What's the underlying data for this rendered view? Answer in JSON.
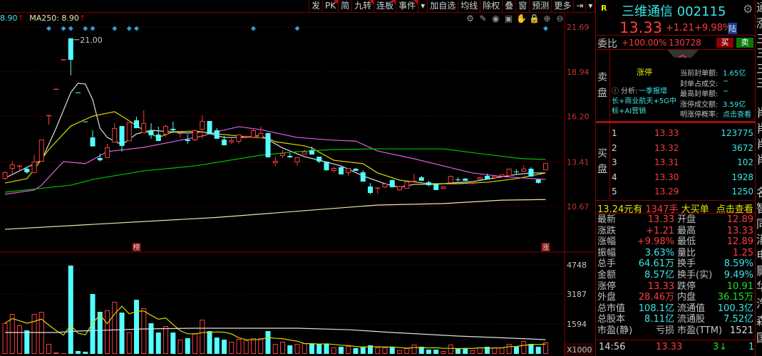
{
  "toolbar": {
    "buttons": [
      {
        "label": "发",
        "corner": false
      },
      {
        "label": "PK",
        "corner": true
      },
      {
        "label": "简",
        "corner": false
      },
      {
        "label": "九转",
        "corner": true
      },
      {
        "label": "连板",
        "corner": true
      },
      {
        "label": "事件",
        "corner": true
      },
      {
        "label": "▾",
        "corner": false
      },
      {
        "label": "加自选",
        "corner": false
      },
      {
        "label": "均线",
        "corner": false
      },
      {
        "label": "除权",
        "corner": false
      },
      {
        "label": "叠",
        "corner": false
      },
      {
        "label": "窗",
        "corner": false
      },
      {
        "label": "预测",
        "corner": false
      },
      {
        "label": "更多",
        "corner": false
      },
      {
        "label": "⇥",
        "corner": false
      },
      {
        "label": "▾",
        "corner": false
      }
    ],
    "tools": [
      {
        "name": "settings-icon",
        "glyph": "⚙"
      },
      {
        "name": "pen-icon",
        "glyph": "✎"
      },
      {
        "name": "eye-icon",
        "glyph": "◉"
      },
      {
        "name": "toolbox-icon",
        "glyph": "▣"
      },
      {
        "name": "hand-icon",
        "glyph": "✋"
      },
      {
        "name": "lock-icon",
        "glyph": "🔒"
      },
      {
        "name": "zoom-in-icon",
        "glyph": "⊕"
      },
      {
        "name": "zoom-out-icon",
        "glyph": "⊖"
      }
    ]
  },
  "legend": {
    "ma_prev_value": "8.90",
    "ma_prev_arrow": "↑",
    "ma250_label": "MA250: 8.90",
    "ma250_arrow": "↑"
  },
  "chart_data": {
    "type": "candlestick",
    "price_axis": {
      "ticks": [
        "21.69",
        "18.94",
        "16.20",
        "13.41",
        "10.67"
      ],
      "tick_values": [
        21.69,
        18.94,
        16.2,
        13.41,
        10.67
      ]
    },
    "volume_axis": {
      "ticks": [
        "4748",
        "3187",
        "1594"
      ],
      "tick_values": [
        4748,
        3187,
        1594
      ],
      "unit_label": "X1000"
    },
    "high_annotation": {
      "label": "21.00",
      "index": 9,
      "value": 21.0
    },
    "candles_ohlc": [
      [
        12.38,
        12.86,
        12.29,
        12.77
      ],
      [
        12.99,
        13.43,
        12.68,
        13.25
      ],
      [
        13.16,
        13.21,
        12.86,
        13.18
      ],
      [
        12.99,
        13.08,
        12.68,
        12.77
      ],
      [
        12.73,
        13.86,
        12.73,
        13.43
      ],
      [
        13.43,
        14.78,
        13.43,
        14.78
      ],
      [
        16.27,
        16.27,
        15.7,
        16.28
      ],
      [
        17.89,
        17.9,
        17.89,
        17.9
      ],
      [
        19.68,
        19.72,
        19.68,
        19.72
      ],
      [
        21.0,
        21.0,
        18.72,
        19.68
      ],
      [
        17.68,
        17.68,
        17.67,
        17.67
      ],
      [
        15.89,
        15.89,
        15.88,
        15.88
      ],
      [
        14.91,
        15.35,
        14.36,
        14.36
      ],
      [
        13.65,
        13.91,
        13.43,
        13.51
      ],
      [
        13.65,
        14.52,
        13.65,
        14.3
      ],
      [
        14.61,
        15.79,
        14.61,
        15.48
      ],
      [
        15.61,
        15.61,
        14.04,
        14.39
      ],
      [
        14.69,
        15.83,
        14.69,
        15.83
      ],
      [
        15.96,
        16.18,
        15.48,
        15.48
      ],
      [
        15.18,
        16.57,
        15.18,
        15.79
      ],
      [
        15.35,
        15.79,
        14.83,
        15.04
      ],
      [
        15.09,
        15.57,
        14.69,
        14.69
      ],
      [
        15.09,
        15.7,
        14.96,
        15.61
      ],
      [
        15.44,
        15.88,
        15.18,
        15.35
      ],
      [
        15.18,
        15.31,
        14.91,
        15.2
      ],
      [
        14.78,
        15.09,
        14.52,
        14.69
      ],
      [
        14.74,
        15.4,
        14.69,
        15.35
      ],
      [
        15.39,
        16.27,
        14.83,
        15.92
      ],
      [
        15.92,
        15.92,
        15.13,
        15.13
      ],
      [
        15.35,
        15.48,
        14.83,
        14.83
      ],
      [
        14.78,
        15.0,
        14.43,
        14.43
      ],
      [
        14.61,
        14.91,
        14.52,
        14.74
      ],
      [
        14.65,
        15.09,
        14.52,
        15.09
      ],
      [
        14.91,
        15.04,
        14.87,
        15.0
      ],
      [
        14.91,
        15.48,
        14.87,
        15.35
      ],
      [
        14.87,
        15.57,
        14.87,
        15.18
      ],
      [
        15.18,
        15.18,
        13.69,
        13.69
      ],
      [
        13.34,
        13.73,
        13.16,
        13.47
      ],
      [
        13.78,
        14.13,
        13.65,
        13.95
      ],
      [
        13.78,
        13.95,
        13.65,
        13.69
      ],
      [
        13.38,
        13.69,
        13.16,
        13.69
      ],
      [
        13.86,
        14.17,
        13.86,
        14.04
      ],
      [
        14.13,
        14.36,
        13.86,
        13.86
      ],
      [
        13.73,
        13.73,
        13.34,
        13.43
      ],
      [
        13.43,
        13.43,
        12.86,
        12.9
      ],
      [
        12.86,
        13.12,
        12.77,
        13.03
      ],
      [
        13.08,
        13.12,
        12.64,
        12.64
      ],
      [
        12.73,
        13.03,
        12.55,
        13.03
      ],
      [
        12.99,
        13.03,
        12.86,
        12.86
      ],
      [
        12.77,
        12.9,
        12.2,
        12.2
      ],
      [
        11.9,
        12.11,
        11.42,
        11.5
      ],
      [
        11.81,
        11.81,
        11.46,
        11.83
      ],
      [
        11.85,
        12.07,
        11.8,
        12.07
      ],
      [
        12.29,
        12.33,
        11.85,
        11.85
      ],
      [
        11.68,
        11.95,
        11.65,
        11.9
      ],
      [
        11.76,
        12.2,
        11.76,
        12.2
      ],
      [
        12.22,
        12.68,
        12.2,
        12.25
      ],
      [
        12.46,
        12.55,
        12.25,
        12.25
      ],
      [
        12.16,
        12.25,
        11.9,
        11.98
      ],
      [
        12.03,
        12.07,
        11.68,
        11.68
      ],
      [
        11.76,
        11.9,
        11.72,
        11.9
      ],
      [
        12.11,
        12.55,
        12.11,
        12.55
      ],
      [
        12.33,
        12.46,
        12.2,
        12.32
      ],
      [
        12.38,
        12.42,
        12.25,
        12.25
      ],
      [
        12.07,
        12.2,
        12.03,
        12.16
      ],
      [
        12.33,
        12.46,
        12.33,
        12.46
      ],
      [
        12.55,
        12.68,
        12.33,
        12.33
      ],
      [
        12.42,
        12.55,
        12.42,
        12.55
      ],
      [
        12.51,
        12.64,
        12.51,
        12.64
      ],
      [
        12.55,
        12.99,
        12.55,
        12.99
      ],
      [
        12.82,
        12.95,
        12.68,
        12.81
      ],
      [
        12.81,
        13.21,
        12.81,
        12.99
      ],
      [
        12.99,
        13.08,
        12.51,
        12.51
      ],
      [
        12.33,
        12.33,
        12.07,
        12.12
      ],
      [
        12.89,
        13.33,
        12.89,
        13.33
      ]
    ],
    "volumes": [
      1640,
      2128,
      1520,
      1254,
      2128,
      2242,
      532,
      76,
      40,
      4712,
      152,
      114,
      3192,
      2242,
      2318,
      2774,
      2204,
      1140,
      2888,
      2432,
      1634,
      1140,
      1482,
      1140,
      760,
      836,
      1102,
      1824,
      1216,
      874,
      760,
      646,
      798,
      722,
      836,
      836,
      1216,
      532,
      646,
      456,
      532,
      570,
      532,
      532,
      532,
      342,
      380,
      418,
      304,
      380,
      456,
      342,
      342,
      342,
      190,
      304,
      494,
      380,
      228,
      228,
      152,
      494,
      304,
      304,
      190,
      342,
      380,
      342,
      342,
      532,
      380,
      684,
      532,
      380,
      608
    ],
    "ma_lines": [
      {
        "name": "MA5",
        "color": "#e0e0e0",
        "points": [
          [
            0,
            12.42
          ],
          [
            5,
            13.51
          ],
          [
            7,
            15.48
          ],
          [
            9,
            17.67
          ],
          [
            10,
            18.24
          ],
          [
            11,
            18.19
          ],
          [
            12,
            17.23
          ],
          [
            13,
            15.48
          ],
          [
            14,
            14.91
          ],
          [
            16,
            14.47
          ],
          [
            18,
            15.13
          ],
          [
            20,
            15.35
          ],
          [
            25,
            15.18
          ],
          [
            27,
            15.26
          ],
          [
            30,
            14.91
          ],
          [
            33,
            14.91
          ],
          [
            35,
            15.04
          ],
          [
            38,
            14.26
          ],
          [
            41,
            13.73
          ],
          [
            44,
            13.4
          ],
          [
            46,
            13.16
          ],
          [
            49,
            12.55
          ],
          [
            52,
            12.07
          ],
          [
            54,
            11.85
          ],
          [
            56,
            12.03
          ],
          [
            59,
            12.03
          ],
          [
            61,
            12.11
          ],
          [
            64,
            12.2
          ],
          [
            67,
            12.42
          ],
          [
            70,
            12.64
          ],
          [
            72,
            12.73
          ],
          [
            74,
            12.73
          ]
        ]
      },
      {
        "name": "MA10",
        "color": "#d8d800",
        "points": [
          [
            0,
            12.11
          ],
          [
            3,
            12.38
          ],
          [
            4,
            12.95
          ],
          [
            6,
            14.17
          ],
          [
            9,
            15.61
          ],
          [
            12,
            16.22
          ],
          [
            15,
            16.49
          ],
          [
            16,
            16.22
          ],
          [
            19,
            15.35
          ],
          [
            21,
            14.91
          ],
          [
            23,
            15.26
          ],
          [
            26,
            15.3
          ],
          [
            29,
            15.13
          ],
          [
            33,
            14.96
          ],
          [
            36,
            14.85
          ],
          [
            37,
            14.65
          ],
          [
            41,
            14.39
          ],
          [
            42,
            14.26
          ],
          [
            45,
            13.51
          ],
          [
            49,
            13.3
          ],
          [
            51,
            12.73
          ],
          [
            54,
            12.29
          ],
          [
            58,
            12.07
          ],
          [
            62,
            12.07
          ],
          [
            66,
            12.16
          ],
          [
            70,
            12.38
          ],
          [
            74,
            12.73
          ]
        ]
      },
      {
        "name": "MA20",
        "color": "#e060e0",
        "points": [
          [
            0,
            11.42
          ],
          [
            4,
            11.68
          ],
          [
            5,
            11.98
          ],
          [
            8,
            13.43
          ],
          [
            11,
            13.3
          ],
          [
            14,
            14.04
          ],
          [
            19,
            14.3
          ],
          [
            24,
            14.74
          ],
          [
            27,
            15.0
          ],
          [
            29,
            15.26
          ],
          [
            32,
            15.57
          ],
          [
            35,
            15.39
          ],
          [
            40,
            14.91
          ],
          [
            45,
            14.74
          ],
          [
            48,
            14.69
          ],
          [
            51,
            14.08
          ],
          [
            56,
            13.6
          ],
          [
            60,
            13.16
          ],
          [
            64,
            12.73
          ],
          [
            68,
            12.51
          ],
          [
            74,
            12.33
          ]
        ]
      },
      {
        "name": "MA60",
        "color": "#00c000",
        "points": [
          [
            0,
            11.55
          ],
          [
            9,
            11.98
          ],
          [
            12,
            12.33
          ],
          [
            19,
            12.86
          ],
          [
            26,
            13.16
          ],
          [
            35,
            13.82
          ],
          [
            40,
            14.04
          ],
          [
            45,
            14.17
          ],
          [
            51,
            14.21
          ],
          [
            60,
            14.21
          ],
          [
            66,
            13.86
          ],
          [
            71,
            13.6
          ],
          [
            74,
            13.56
          ]
        ]
      },
      {
        "name": "MA250",
        "color": "#e8e8b0",
        "points": [
          [
            0,
            9.27
          ],
          [
            29,
            10.0
          ],
          [
            51,
            10.76
          ],
          [
            60,
            10.85
          ],
          [
            68,
            11.06
          ],
          [
            74,
            11.1
          ]
        ]
      }
    ],
    "volume_ma_lines": [
      {
        "name": "VOL-MA-long",
        "color": "#e0e0e0",
        "points": [
          [
            0,
            1140
          ],
          [
            7,
            1140
          ],
          [
            10,
            1216
          ],
          [
            19,
            1330
          ],
          [
            26,
            1368
          ],
          [
            40,
            1368
          ],
          [
            47,
            1290
          ],
          [
            53,
            1140
          ],
          [
            62,
            950
          ],
          [
            67,
            874
          ],
          [
            74,
            760
          ]
        ]
      }
    ],
    "volume_ma5_color": "#d8d800",
    "event_marker_indices": [
      6,
      8,
      9,
      11,
      12,
      15,
      17,
      18,
      34,
      40,
      74
    ],
    "tags": [
      {
        "label": "榜",
        "index": 18
      },
      {
        "label": "涨",
        "index": 74
      }
    ]
  },
  "quote": {
    "badge": "R",
    "title": "三维通信 002115",
    "price": "13.33",
    "change": "+1.21",
    "change_pct": "+9.98%",
    "market_badge": "陆",
    "wei_bi_label": "委比",
    "wei_bi": "+100.00%",
    "wei_cha": "130728",
    "buy_label": "买",
    "sell_label": "卖",
    "sell_side_label": "卖盘",
    "buy_side_label": "买盘",
    "limit_up": "涨停",
    "analysis_prefix": "分析:",
    "analysis_lines": [
      "一季报增",
      "长+商业航天+5G中",
      "标+AI营销"
    ],
    "seal_info": [
      {
        "label": "当前封单额:",
        "value": "1.65亿"
      },
      {
        "label": "封单占成交:",
        "value": "−"
      },
      {
        "label": "最高封单额:",
        "value": "−"
      },
      {
        "label": "涨停成交额:",
        "value": "3.59亿"
      },
      {
        "label": "明涨停概率:",
        "value": "点击查看"
      }
    ],
    "bids": [
      {
        "level": "1",
        "price": "13.33",
        "volume": "123775"
      },
      {
        "level": "2",
        "price": "13.32",
        "volume": "3672"
      },
      {
        "level": "3",
        "price": "13.31",
        "volume": "102"
      },
      {
        "level": "4",
        "price": "13.30",
        "volume": "1928"
      },
      {
        "level": "5",
        "price": "13.29",
        "volume": "1250"
      }
    ],
    "big_order": {
      "price": "13.24元有",
      "qty": "1347手",
      "text": "大买单",
      "link": "点击查看"
    },
    "stats": [
      {
        "l1": "最新",
        "v1": "13.33",
        "c1": "red",
        "l2": "开盘",
        "v2": "12.89",
        "c2": "red"
      },
      {
        "l1": "涨跌",
        "v1": "+1.21",
        "c1": "red",
        "l2": "最高",
        "v2": "13.33",
        "c2": "red"
      },
      {
        "l1": "涨幅",
        "v1": "+9.98%",
        "c1": "red",
        "l2": "最低",
        "v2": "12.89",
        "c2": "red"
      },
      {
        "l1": "振幅",
        "v1": "3.63%",
        "c1": "cyan",
        "l2": "量比",
        "v2": "1.25",
        "c2": "red"
      },
      {
        "l1": "总手",
        "v1": "64.61万",
        "c1": "cyan",
        "l2": "换手",
        "v2": "8.59%",
        "c2": "cyan"
      },
      {
        "l1": "金额",
        "v1": "8.57亿",
        "c1": "cyan",
        "l2": "换手(实)",
        "v2": "9.49%",
        "c2": "cyan"
      },
      {
        "l1": "涨停",
        "v1": "13.33",
        "c1": "red",
        "l2": "跌停",
        "v2": "10.91",
        "c2": "green"
      },
      {
        "l1": "外盘",
        "v1": "28.46万",
        "c1": "red",
        "l2": "内盘",
        "v2": "36.15万",
        "c2": "green"
      },
      {
        "l1": "总市值",
        "v1": "108.1亿",
        "c1": "cyan",
        "l2": "流通值",
        "v2": "100.3亿",
        "c2": "cyan"
      },
      {
        "l1": "总股本",
        "v1": "8.11亿",
        "c1": "cyan",
        "l2": "流通股",
        "v2": "7.52亿",
        "c2": "cyan"
      },
      {
        "l1": "市盈(静)",
        "v1": "亏损",
        "c1": "gray",
        "l2": "市盈(TTM)",
        "v2": "1521",
        "c2": "white"
      }
    ],
    "tick": {
      "time": "14:56",
      "price": "13.33",
      "volume": "3",
      "direction_icon": "↓",
      "count": "1"
    }
  },
  "edge_panel_glyphs": [
    "通",
    "涨",
    "三",
    "三",
    "三",
    "三",
    "肖",
    "肖",
    "肖",
    "肖",
    "名",
    "智",
    "同",
    "消",
    "电",
    "影",
    "华",
    "汽",
    "森",
    "国"
  ],
  "colors": {
    "up": "#ff3c3c",
    "down": "#54ffff",
    "grid": "#8a0000",
    "accent_cyan": "#3ce6e6"
  }
}
